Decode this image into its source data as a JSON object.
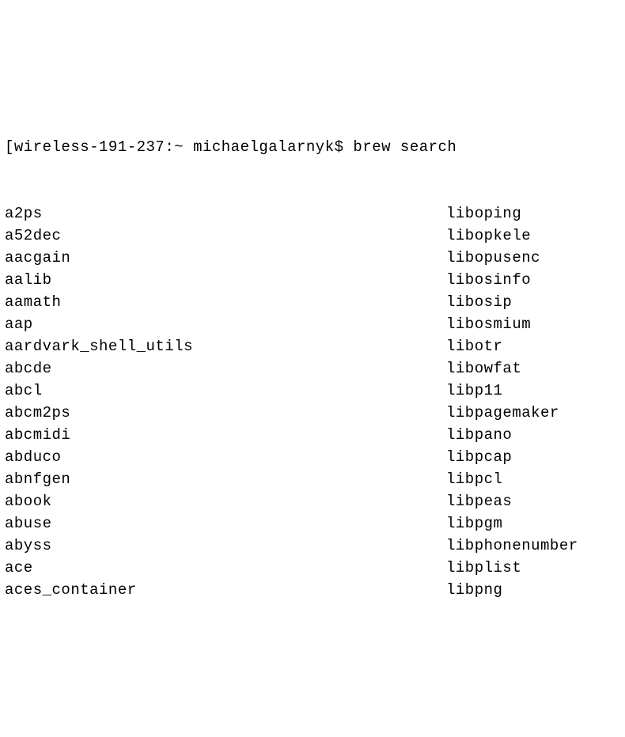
{
  "prompt": {
    "bracket_open": "[",
    "host": "wireless-191-237",
    "sep": ":~ ",
    "user": "michaelgalarnyk",
    "dollar": "$ ",
    "command": "brew search"
  },
  "packages_left": [
    "a2ps",
    "a52dec",
    "aacgain",
    "aalib",
    "aamath",
    "aap",
    "aardvark_shell_utils",
    "abcde",
    "abcl",
    "abcm2ps",
    "abcmidi",
    "abduco",
    "abnfgen",
    "abook",
    "abuse",
    "abyss",
    "ace",
    "aces_container"
  ],
  "packages_right": [
    "liboping",
    "libopkele",
    "libopusenc",
    "libosinfo",
    "libosip",
    "libosmium",
    "libotr",
    "libowfat",
    "libp11",
    "libpagemaker",
    "libpano",
    "libpcap",
    "libpcl",
    "libpeas",
    "libpgm",
    "libphonenumber",
    "libplist",
    "libpng"
  ]
}
